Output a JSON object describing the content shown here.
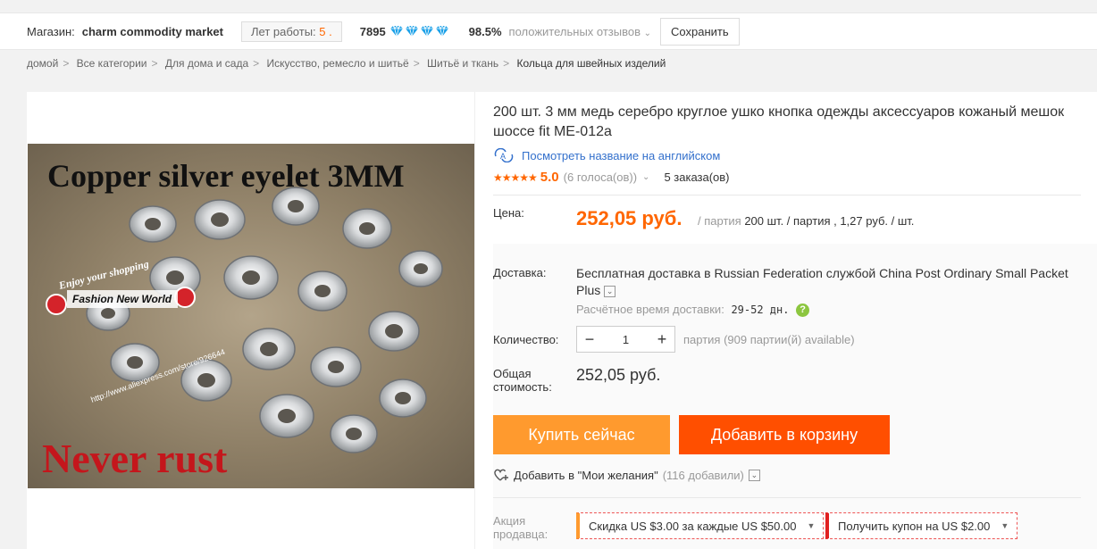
{
  "store": {
    "label": "Магазин:",
    "name": "charm commodity market",
    "years_label": "Лет работы:",
    "years_value": "5 .",
    "score": "7895",
    "diamond_count": 4,
    "diamond_color": "#1aa0e8",
    "positive_pct": "98.5%",
    "positive_label": "положительных отзывов",
    "save_label": "Сохранить"
  },
  "breadcrumb": {
    "items": [
      "домой",
      "Все категории",
      "Для дома и сада",
      "Искусство, ремесло и шитьё",
      "Шитьё и ткань"
    ],
    "current": "Кольца для швейных изделий",
    "separator": ">"
  },
  "product": {
    "image_caption_top": "Copper silver eyelet  3MM",
    "image_caption_bottom": "Never rust",
    "image_stamp_text": "Enjoy your shopping",
    "image_stamp_name": "Fashion New World",
    "image_url_text": "http://www.aliexpress.com/store/926644",
    "title": "200 шт. 3 мм медь серебро круглое ушко кнопка одежды аксессуаров кожаный мешок шоссе fit ME-012a",
    "translate_link": "Посмотреть название на английском",
    "stars": "★★★★★",
    "rating": "5.0",
    "votes": "(6 голоса(ов))",
    "orders": "5 заказа(ов)",
    "price_label": "Цена:",
    "price": "252,05 руб.",
    "price_unit_prefix": "/ партия",
    "price_unit_detail": "200 шт. / партия , 1,27 руб. / шт.",
    "shipping_label": "Доставка:",
    "shipping_text": "Бесплатная доставка в Russian Federation службой China Post Ordinary Small Packet Plus",
    "eta_label": "Расчётное время доставки:",
    "eta_days": "29-52 дн.",
    "quantity_label": "Количество:",
    "quantity_value": "1",
    "quantity_note": "партия (909 партии(й) available)",
    "total_label": "Общая стоимость:",
    "total": "252,05 руб.",
    "buy_now": "Купить сейчас",
    "add_to_cart": "Добавить в корзину",
    "wishlist": "Добавить в \"Мои желания\"",
    "wishlist_count": "(116 добавили)",
    "promo_label": "Акция продавца:",
    "coupon1": "Скидка US $3.00 за каждые US $50.00",
    "coupon2": "Получить купон на US $2.00"
  },
  "colors": {
    "accent_orange": "#ff6600",
    "buy_button": "#ff9a2e",
    "cart_button": "#ff4f00",
    "link": "#3370cc"
  }
}
